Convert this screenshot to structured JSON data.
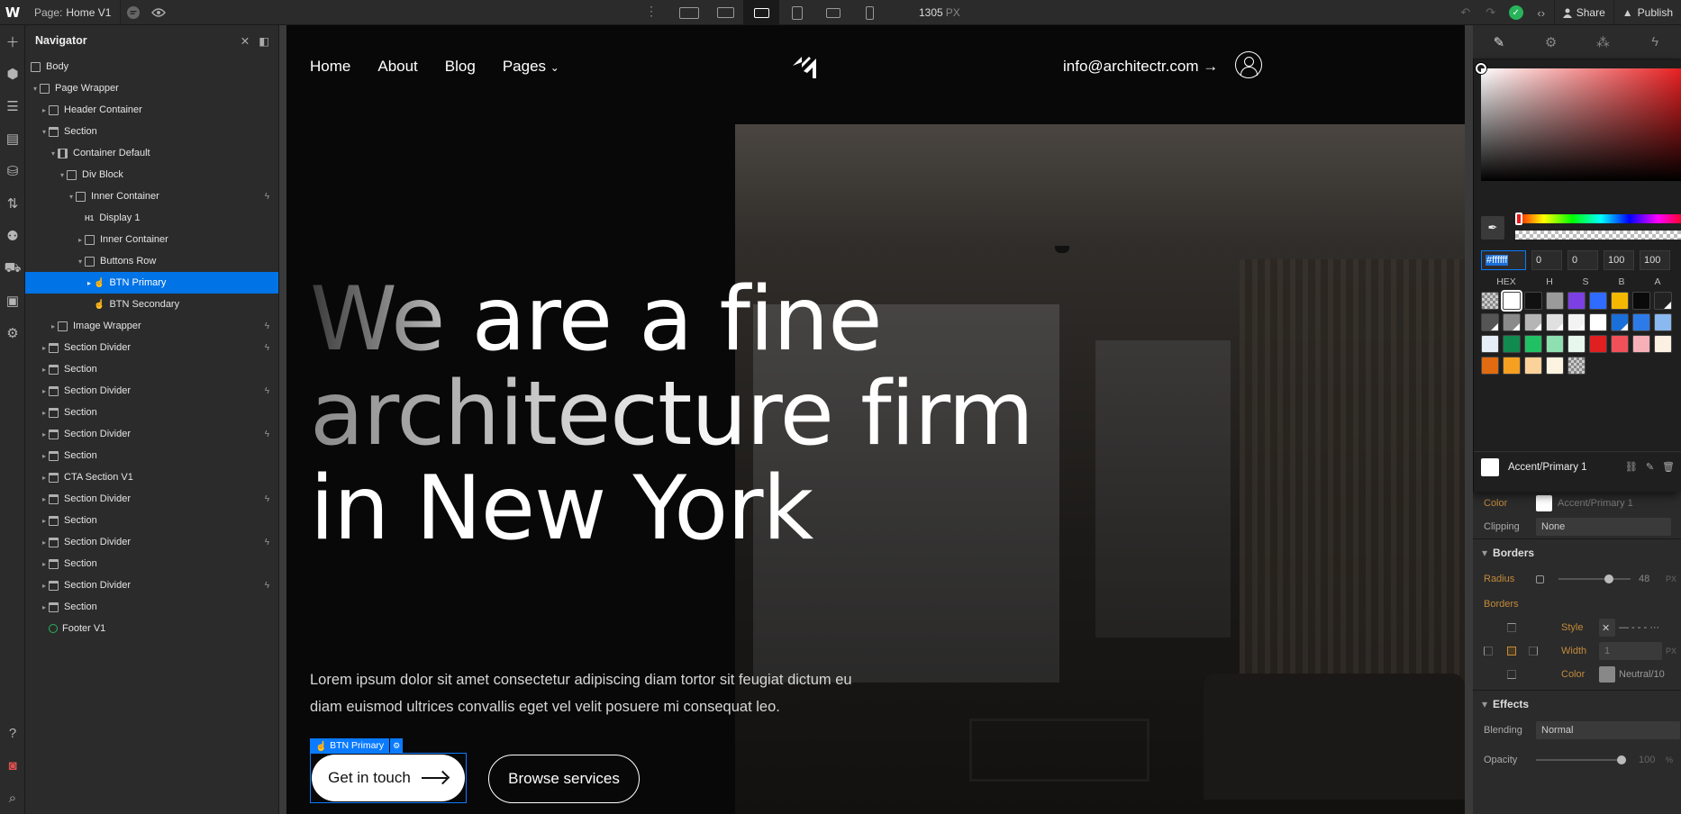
{
  "topbar": {
    "logo": "W",
    "page_prefix": "Page:",
    "page_name": "Home V1",
    "canvas_width": "1305",
    "canvas_unit": "PX",
    "share": "Share",
    "publish": "Publish"
  },
  "navigator": {
    "title": "Navigator",
    "nodes": [
      {
        "label": "Body"
      },
      {
        "label": "Page Wrapper"
      },
      {
        "label": "Header Container"
      },
      {
        "label": "Section"
      },
      {
        "label": "Container Default"
      },
      {
        "label": "Div Block"
      },
      {
        "label": "Inner Container"
      },
      {
        "label": "Display 1"
      },
      {
        "label": "Inner Container"
      },
      {
        "label": "Buttons Row"
      },
      {
        "label": "BTN Primary"
      },
      {
        "label": "BTN Secondary"
      },
      {
        "label": "Image Wrapper"
      },
      {
        "label": "Section Divider"
      },
      {
        "label": "Section"
      },
      {
        "label": "Section Divider"
      },
      {
        "label": "Section"
      },
      {
        "label": "Section Divider"
      },
      {
        "label": "Section"
      },
      {
        "label": "CTA Section V1"
      },
      {
        "label": "Section Divider"
      },
      {
        "label": "Section"
      },
      {
        "label": "Section Divider"
      },
      {
        "label": "Section"
      },
      {
        "label": "Section Divider"
      },
      {
        "label": "Section"
      },
      {
        "label": "Footer V1"
      }
    ]
  },
  "site": {
    "nav": [
      "Home",
      "About",
      "Blog",
      "Pages"
    ],
    "email": "info@architectr.com",
    "hero_line1_dim": "We",
    "hero_line1_rest": " are a fine",
    "hero_line2": "architecture firm",
    "hero_line3": "in New York",
    "subtext": "Lorem ipsum dolor sit amet consectetur adipiscing diam tortor sit feugiat dictum eu diam euismod ultrices convallis eget vel velit posuere mi consequat leo.",
    "selection_tag": "BTN Primary",
    "btn_primary": "Get in touch",
    "btn_secondary": "Browse services"
  },
  "picker": {
    "hex": "#ffffff",
    "h": "0",
    "s": "0",
    "b": "100",
    "a": "100",
    "labels": [
      "HEX",
      "H",
      "S",
      "B",
      "A"
    ],
    "swatch_name": "Accent/Primary 1",
    "swatches": [
      "chk",
      "#ffffff",
      "#111111",
      "#9a9a9a",
      "#7b3fe4",
      "#2f6bff",
      "#f5b800",
      "#0a0a0a",
      "#222222",
      "#555555",
      "#8a8a8a",
      "#b5b5b5",
      "#e0e0e0",
      "#f3f3f3",
      "#ffffff",
      "#1a6fd8",
      "#2d7be8",
      "#8ab8f0",
      "#e6eef8",
      "#118a4f",
      "#22c065",
      "#8fe0b0",
      "#e8f7ee",
      "#e02020",
      "#f0505a",
      "#f7b0b8",
      "#fbf0e2",
      "#e06b10",
      "#f5a020",
      "#fbd29a",
      "#fcf3e0",
      "chk"
    ],
    "swatches_selected_index": 1
  },
  "props": {
    "color_label": "Color",
    "color_value": "Accent/Primary 1",
    "clipping_label": "Clipping",
    "clipping_value": "None",
    "borders_title": "Borders",
    "radius_label": "Radius",
    "radius_value": "48",
    "radius_unit": "PX",
    "borders_label": "Borders",
    "style_label": "Style",
    "width_label": "Width",
    "width_value": "1",
    "width_unit": "PX",
    "bcolor_label": "Color",
    "bcolor_value": "Neutral/10",
    "effects_title": "Effects",
    "blending_label": "Blending",
    "blending_value": "Normal",
    "opacity_label": "Opacity",
    "opacity_value": "100",
    "opacity_unit": "%"
  },
  "colors": {
    "selection": "#0073e6",
    "accent_green": "#27b35a"
  }
}
